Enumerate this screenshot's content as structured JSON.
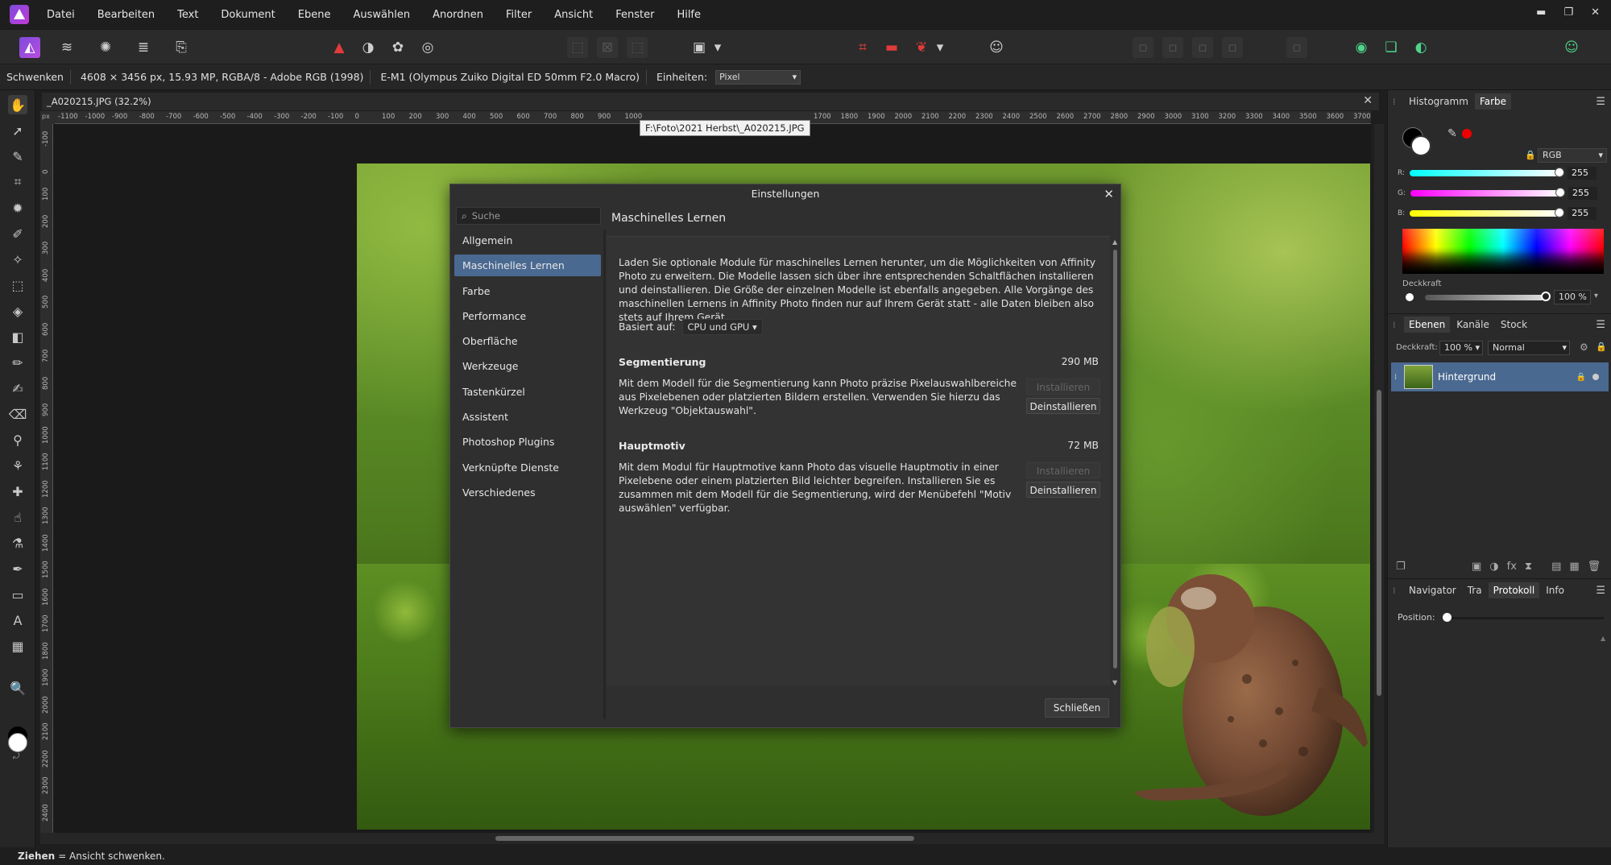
{
  "menubar": {
    "items": [
      "Datei",
      "Bearbeiten",
      "Text",
      "Dokument",
      "Ebene",
      "Auswählen",
      "Anordnen",
      "Filter",
      "Ansicht",
      "Fenster",
      "Hilfe"
    ],
    "minimize": "▬",
    "restore": "❐",
    "close": "✕"
  },
  "context": {
    "tool": "Schwenken",
    "doc_info": "4608 × 3456 px, 15.93 MP, RGBA/8 - Adobe RGB (1998)",
    "camera": "E-M1 (Olympus Zuiko Digital ED 50mm F2.0 Macro)",
    "units_label": "Einheiten:",
    "units_value": "Pixel"
  },
  "document": {
    "tab_title": "_A020215.JPG (32.2%)",
    "tooltip": "F:\\Foto\\2021 Herbst\\_A020215.JPG",
    "ruler_unit": "px",
    "hruler_ticks": [
      "-1100",
      "-1000",
      "-900",
      "-800",
      "-700",
      "-600",
      "-500",
      "-400",
      "-300",
      "-200",
      "-100",
      "0",
      "100",
      "200",
      "300",
      "400",
      "500",
      "600",
      "700",
      "800",
      "900",
      "1000",
      "1700",
      "1800",
      "1900",
      "2000",
      "2100",
      "2200",
      "2300",
      "2400",
      "2500",
      "2600",
      "2700",
      "2800",
      "2900",
      "3000",
      "3100",
      "3200",
      "3300",
      "3400",
      "3500",
      "3600",
      "3700"
    ],
    "vruler_ticks": [
      "-100",
      "0",
      "100",
      "200",
      "300",
      "400",
      "500",
      "600",
      "700",
      "800",
      "900",
      "1000",
      "1100",
      "1200",
      "1300",
      "1400",
      "1500",
      "1600",
      "1700",
      "1800",
      "1900",
      "2000",
      "2100",
      "2200",
      "2300",
      "2400"
    ]
  },
  "dialog": {
    "title": "Einstellungen",
    "search_placeholder": "Suche",
    "nav": [
      "Allgemein",
      "Maschinelles Lernen",
      "Farbe",
      "Performance",
      "Oberfläche",
      "Werkzeuge",
      "Tastenkürzel",
      "Assistent",
      "Photoshop Plugins",
      "Verknüpfte Dienste",
      "Verschiedenes"
    ],
    "active_nav": "Maschinelles Lernen",
    "heading": "Maschinelles Lernen",
    "intro": "Laden Sie optionale Module für maschinelles Lernen herunter, um die Möglichkeiten von Affinity Photo zu erweitern. Die Modelle lassen sich über ihre entsprechenden Schaltflächen installieren und deinstallieren. Die Größe der einzelnen Modelle ist ebenfalls angegeben. Alle Vorgänge des maschinellen Lernens in Affinity Photo finden nur auf Ihrem Gerät statt - alle Daten bleiben also stets auf Ihrem Gerät.",
    "based_on_label": "Basiert auf:",
    "based_on_value": "CPU und GPU",
    "segmentation": {
      "title": "Segmentierung",
      "size": "290 MB",
      "desc": "Mit dem Modell für die Segmentierung kann Photo präzise Pixelauswahlbereiche aus Pixelebenen oder platzierten Bildern erstellen. Verwenden Sie hierzu das Werkzeug \"Objektauswahl\".",
      "install": "Installieren",
      "uninstall": "Deinstallieren"
    },
    "subject": {
      "title": "Hauptmotiv",
      "size": "72 MB",
      "desc": "Mit dem Modul für Hauptmotive kann Photo das visuelle Hauptmotiv in einer Pixelebene oder einem platzierten Bild leichter begreifen. Installieren Sie es zusammen mit dem Modell für die Segmentierung, wird der Menübefehl \"Motiv auswählen\" verfügbar.",
      "install": "Installieren",
      "uninstall": "Deinstallieren"
    },
    "close_button": "Schließen"
  },
  "color_panel": {
    "tabs": [
      "Histogramm",
      "Farbe"
    ],
    "active_tab": "Farbe",
    "mode": "RGB",
    "r_label": "R:",
    "r_value": "255",
    "g_label": "G:",
    "g_value": "255",
    "b_label": "B:",
    "b_value": "255",
    "opacity_label": "Deckkraft",
    "opacity_value": "100 %"
  },
  "layers_panel": {
    "tabs": [
      "Ebenen",
      "Kanäle",
      "Stock"
    ],
    "active_tab": "Ebenen",
    "opacity_label": "Deckkraft:",
    "opacity_value": "100 %",
    "blend_mode": "Normal",
    "layer_name": "Hintergrund"
  },
  "history_panel": {
    "tabs": [
      "Navigator",
      "Tra",
      "Protokoll",
      "Info"
    ],
    "active_tab": "Protokoll",
    "position_label": "Position:"
  },
  "status": {
    "bold": "Ziehen",
    "text": "= Ansicht schwenken."
  },
  "colors": {
    "accent": "#4a6991",
    "dialog_bg": "#2f2f2f",
    "app_bg": "#1e1e1e"
  }
}
